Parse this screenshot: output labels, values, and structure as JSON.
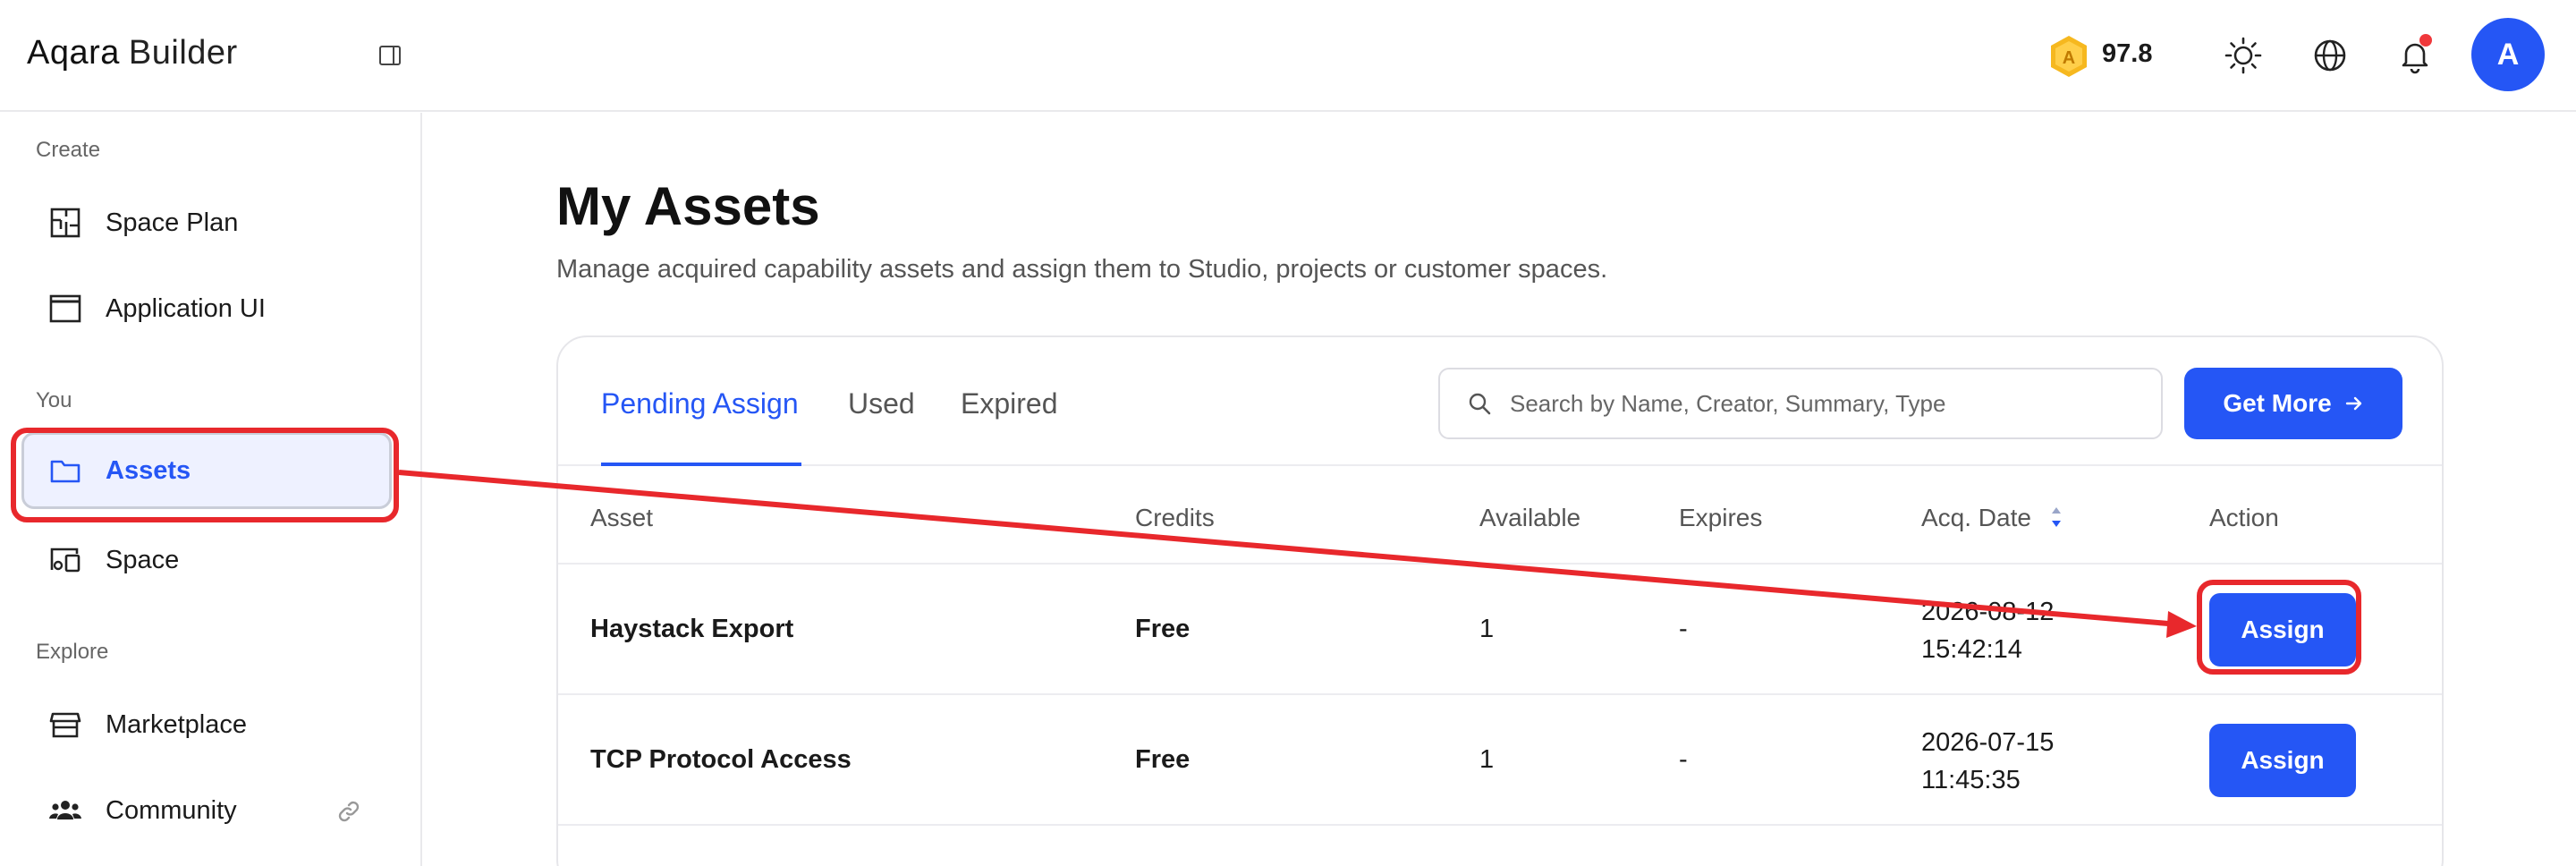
{
  "header": {
    "logo_brand": "Aqara",
    "logo_sub": "Builder",
    "credits": "97.8",
    "avatar_letter": "A",
    "icons": [
      "sidebar-toggle-icon",
      "coin-icon",
      "sun-icon",
      "globe-icon",
      "bell-icon"
    ],
    "notification_dot_color": "#f0383b"
  },
  "sidebar": {
    "sections": [
      {
        "title": "Create",
        "items": [
          {
            "label": "Space Plan",
            "icon": "floorplan-icon"
          },
          {
            "label": "Application UI",
            "icon": "window-icon"
          }
        ]
      },
      {
        "title": "You",
        "items": [
          {
            "label": "Assets",
            "icon": "folder-icon",
            "active": true
          },
          {
            "label": "Space",
            "icon": "devices-icon"
          }
        ]
      },
      {
        "title": "Explore",
        "items": [
          {
            "label": "Marketplace",
            "icon": "store-icon"
          },
          {
            "label": "Community",
            "icon": "people-icon",
            "external": true
          }
        ]
      }
    ]
  },
  "main": {
    "title": "My Assets",
    "description": "Manage acquired capability assets and assign them to Studio, projects or customer spaces.",
    "tabs": [
      {
        "label": "Pending Assign",
        "active": true
      },
      {
        "label": "Used"
      },
      {
        "label": "Expired"
      }
    ],
    "search": {
      "placeholder": "Search by Name, Creator, Summary, Type",
      "value": ""
    },
    "get_more_label": "Get More",
    "columns": [
      "Asset",
      "Credits",
      "Available",
      "Expires",
      "Acq. Date",
      "Action"
    ],
    "rows": [
      {
        "asset": "Haystack Export",
        "credits": "Free",
        "available": "1",
        "expires": "-",
        "date_line1": "2026-08-12",
        "date_line2": "15:42:14",
        "action": "Assign"
      },
      {
        "asset": "TCP Protocol Access",
        "credits": "Free",
        "available": "1",
        "expires": "-",
        "date_line1": "2026-07-15",
        "date_line2": "11:45:35",
        "action": "Assign"
      }
    ]
  },
  "colors": {
    "accent": "#2556f5",
    "highlight_annotation": "#e8282c",
    "active_nav_bg": "#eef1ff"
  }
}
